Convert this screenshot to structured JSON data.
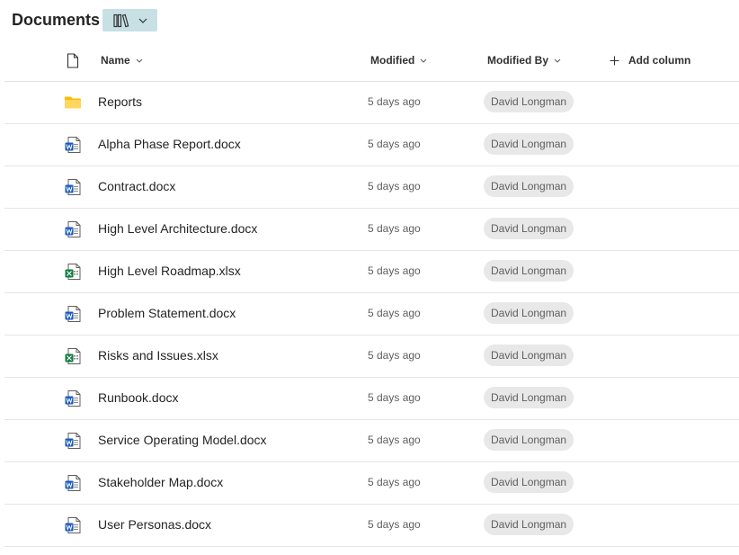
{
  "library": {
    "title": "Documents",
    "view_icon": "library-icon",
    "view_chevron": "chevron-down-icon"
  },
  "header": {
    "type_icon": "file-icon",
    "name": "Name",
    "modified": "Modified",
    "modified_by": "Modified By",
    "add_column": "Add column",
    "add_icon": "plus-icon",
    "sort_icon": "chevron-down-icon"
  },
  "colors": {
    "accent_bg": "#c7e0e4",
    "folder": "#ffc83d",
    "word": "#185abd",
    "excel": "#107c41",
    "pill_bg": "#e8e8e8"
  },
  "files": [
    {
      "name": "Reports",
      "type": "folder",
      "modified": "5 days ago",
      "modified_by": "David Longman"
    },
    {
      "name": "Alpha Phase Report.docx",
      "type": "word",
      "modified": "5 days ago",
      "modified_by": "David Longman"
    },
    {
      "name": "Contract.docx",
      "type": "word",
      "modified": "5 days ago",
      "modified_by": "David Longman"
    },
    {
      "name": "High Level Architecture.docx",
      "type": "word",
      "modified": "5 days ago",
      "modified_by": "David Longman"
    },
    {
      "name": "High Level Roadmap.xlsx",
      "type": "excel",
      "modified": "5 days ago",
      "modified_by": "David Longman"
    },
    {
      "name": "Problem Statement.docx",
      "type": "word",
      "modified": "5 days ago",
      "modified_by": "David Longman"
    },
    {
      "name": "Risks and Issues.xlsx",
      "type": "excel",
      "modified": "5 days ago",
      "modified_by": "David Longman"
    },
    {
      "name": "Runbook.docx",
      "type": "word",
      "modified": "5 days ago",
      "modified_by": "David Longman"
    },
    {
      "name": "Service Operating Model.docx",
      "type": "word",
      "modified": "5 days ago",
      "modified_by": "David Longman"
    },
    {
      "name": "Stakeholder Map.docx",
      "type": "word",
      "modified": "5 days ago",
      "modified_by": "David Longman"
    },
    {
      "name": "User Personas.docx",
      "type": "word",
      "modified": "5 days ago",
      "modified_by": "David Longman"
    }
  ]
}
